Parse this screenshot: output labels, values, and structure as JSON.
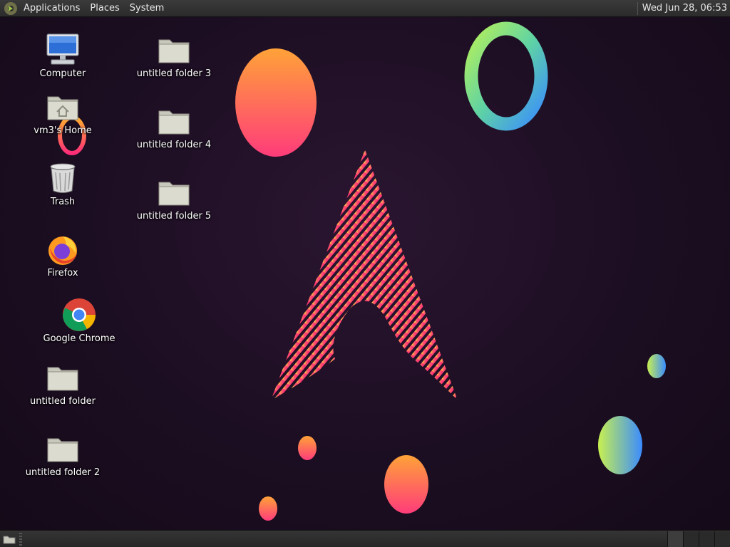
{
  "top_panel": {
    "menus": [
      "Applications",
      "Places",
      "System"
    ],
    "clock": "Wed Jun 28, 06:53"
  },
  "desktop_icons": {
    "computer": "Computer",
    "home": "vm3's Home",
    "trash": "Trash",
    "firefox": "Firefox",
    "chrome": "Google Chrome",
    "folder1": "untitled folder",
    "folder2": "untitled folder 2",
    "folder3": "untitled folder 3",
    "folder4": "untitled folder 4",
    "folder5": "untitled folder 5"
  },
  "wallpaper": {
    "background": "#1c0e22",
    "accent_pink": "#ff2d78",
    "accent_orange": "#ffa238",
    "accent_yellow": "#ffe23a"
  },
  "bottom_panel": {
    "workspace_count": 4,
    "active_workspace": 1
  }
}
